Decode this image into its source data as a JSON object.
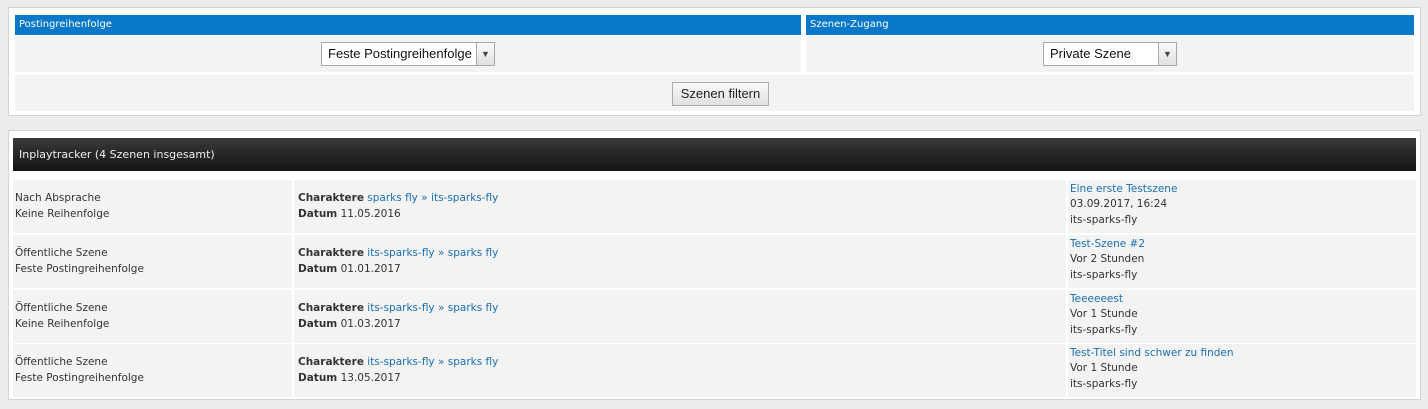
{
  "filters": {
    "posting_order": {
      "heading": "Postingreihenfolge",
      "selected": "Feste Postingreihenfolge"
    },
    "scene_access": {
      "heading": "Szenen-Zugang",
      "selected": "Private Szene"
    },
    "filter_button": "Szenen filtern"
  },
  "tracker": {
    "title": "Inplaytracker (4 Szenen insgesamt)",
    "characters_label": "Charaktere",
    "date_label": "Datum",
    "separator": "»",
    "rows": [
      {
        "access": "Nach Absprache",
        "order": "Keine Reihenfolge",
        "char1": "sparks fly",
        "char2": "its-sparks-fly",
        "date": "11.05.2016",
        "scene_title": "Eine erste Testszene",
        "last_post": "03.09.2017, 16:24",
        "last_user": "its-sparks-fly"
      },
      {
        "access": "Öffentliche Szene",
        "order": "Feste Postingreihenfolge",
        "char1": "its-sparks-fly",
        "char2": "sparks fly",
        "date": "01.01.2017",
        "scene_title": "Test-Szene #2",
        "last_post": "Vor 2 Stunden",
        "last_user": "its-sparks-fly"
      },
      {
        "access": "Öffentliche Szene",
        "order": "Keine Reihenfolge",
        "char1": "its-sparks-fly",
        "char2": "sparks fly",
        "date": "01.03.2017",
        "scene_title": "Teeeeeest",
        "last_post": "Vor 1 Stunde",
        "last_user": "its-sparks-fly"
      },
      {
        "access": "Öffentliche Szene",
        "order": "Feste Postingreihenfolge",
        "char1": "its-sparks-fly",
        "char2": "sparks fly",
        "date": "13.05.2017",
        "scene_title": "Test-Titel sind schwer zu finden",
        "last_post": "Vor 1 Stunde",
        "last_user": "its-sparks-fly"
      }
    ]
  },
  "colors": {
    "header_blue": "#0a78c9",
    "link": "#1a6fb0",
    "tracker_header": "#1e1e1e"
  }
}
